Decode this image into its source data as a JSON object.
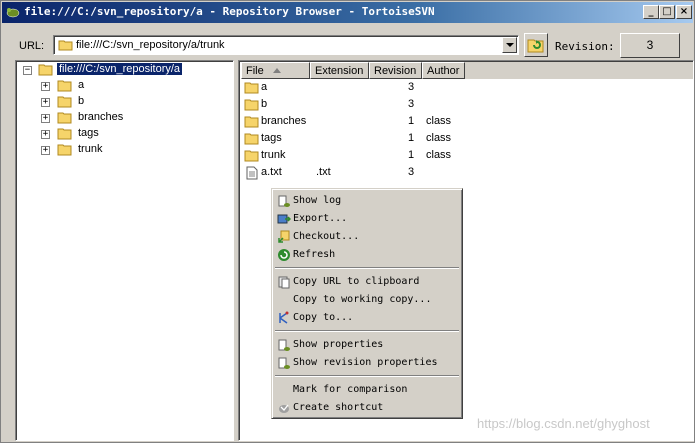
{
  "window": {
    "title": "file:///C:/svn_repository/a - Repository Browser - TortoiseSVN",
    "buttons": {
      "minimize": "_",
      "maximize": "□",
      "close": "×"
    }
  },
  "urlbar": {
    "label": "URL:",
    "value": "file:///C:/svn_repository/a/trunk",
    "revision_label": "Revision:",
    "revision_value": "3"
  },
  "tree": {
    "root": "file:///C:/svn_repository/a",
    "root_expander": "−",
    "child_expander": "+",
    "children": [
      "a",
      "b",
      "branches",
      "tags",
      "trunk"
    ]
  },
  "list": {
    "columns": [
      "File",
      "Extension",
      "Revision",
      "Author"
    ],
    "rows": [
      {
        "name": "a",
        "ext": "",
        "rev": "3",
        "author": "",
        "type": "folder"
      },
      {
        "name": "b",
        "ext": "",
        "rev": "3",
        "author": "",
        "type": "folder"
      },
      {
        "name": "branches",
        "ext": "",
        "rev": "1",
        "author": "class",
        "type": "folder"
      },
      {
        "name": "tags",
        "ext": "",
        "rev": "1",
        "author": "class",
        "type": "folder"
      },
      {
        "name": "trunk",
        "ext": "",
        "rev": "1",
        "author": "class",
        "type": "folder"
      },
      {
        "name": "a.txt",
        "ext": ".txt",
        "rev": "3",
        "author": "",
        "type": "file"
      }
    ]
  },
  "context_menu": {
    "groups": [
      [
        "Show log",
        "Export...",
        "Checkout...",
        "Refresh"
      ],
      [
        "Copy URL to clipboard",
        "Copy to working copy...",
        "Copy to..."
      ],
      [
        "Show properties",
        "Show revision properties"
      ],
      [
        "Mark for comparison",
        "Create shortcut"
      ]
    ],
    "icons": [
      [
        "show-log-icon",
        "export-icon",
        "checkout-icon",
        "refresh-icon"
      ],
      [
        "clipboard-icon",
        "none",
        "copy-to-icon"
      ],
      [
        "properties-icon",
        "properties-icon"
      ],
      [
        "none",
        "shortcut-icon"
      ]
    ]
  },
  "watermark": "https://blog.csdn.net/ghyghost",
  "colors": {
    "selection": "#0a246a",
    "folder": "#f6d46a",
    "folder_edge": "#b08a20"
  }
}
